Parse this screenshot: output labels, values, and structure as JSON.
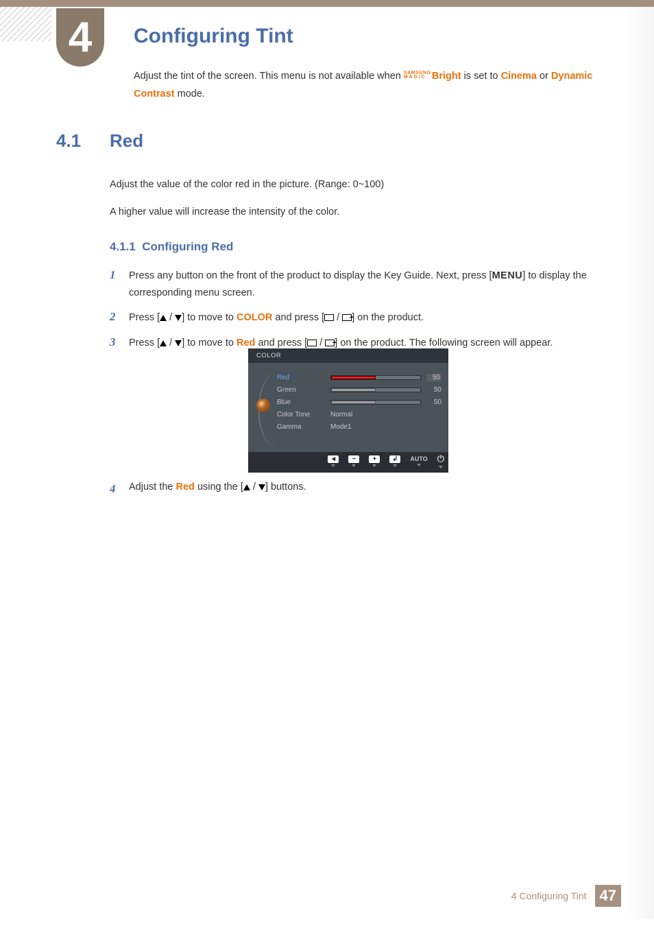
{
  "chapter": {
    "number": "4",
    "title": "Configuring Tint",
    "intro_pre": "Adjust the tint of the screen. This menu is not available when ",
    "magic_line1": "SAMSUNG",
    "magic_line2": "MAGIC",
    "bright_word": "Bright",
    "intro_mid": " is set to ",
    "cinema_word": "Cinema",
    "intro_mid2": " or ",
    "dc_word": "Dynamic Contrast",
    "intro_end": " mode."
  },
  "section": {
    "number": "4.1",
    "title": "Red",
    "para1": "Adjust the value of the color red in the picture. (Range: 0~100)",
    "para2": "A higher value will increase the intensity of the color."
  },
  "subsection": {
    "number": "4.1.1",
    "title": "Configuring Red"
  },
  "steps": {
    "s1_a": "Press any button on the front of the product to display the Key Guide. Next, press [",
    "s1_menu": "MENU",
    "s1_b": "] to display the corresponding menu screen.",
    "s2_a": "Press [",
    "s2_b": "] to move to ",
    "s2_color": "COLOR",
    "s2_c": " and press [",
    "s2_d": "] on the product.",
    "s3_a": "Press [",
    "s3_b": "] to move to ",
    "s3_red": "Red",
    "s3_c": " and press [",
    "s3_d": "] on the product. The following screen will appear.",
    "s4_a": "Adjust the ",
    "s4_red": "Red",
    "s4_b": " using the [",
    "s4_c": "] buttons."
  },
  "osd": {
    "title": "COLOR",
    "rows": {
      "red": "Red",
      "green": "Green",
      "blue": "Blue",
      "color_tone": "Color Tone",
      "gamma": "Gamma"
    },
    "values": {
      "red": "50",
      "green": "50",
      "blue": "50",
      "color_tone": "Normal",
      "gamma": "Mode1"
    },
    "bars": {
      "red_pct": 50,
      "green_pct": 50,
      "blue_pct": 50
    },
    "footer": {
      "back": "◄",
      "minus": "−",
      "plus": "+",
      "enter": "↲",
      "auto": "AUTO",
      "power": "⏻"
    }
  },
  "footer": {
    "label": "4 Configuring Tint",
    "page": "47"
  }
}
